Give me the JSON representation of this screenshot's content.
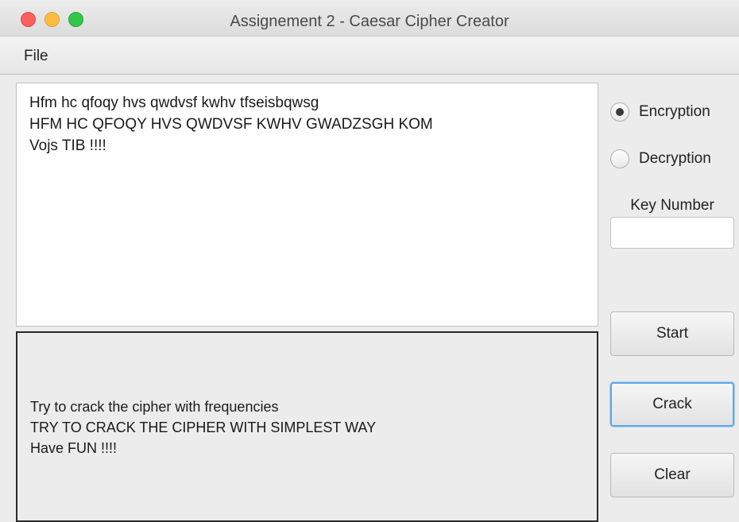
{
  "window": {
    "title": "Assignement 2 - Caesar Cipher Creator"
  },
  "menu": {
    "file_label": "File"
  },
  "input_text": "Hfm hc qfoqy hvs qwdvsf kwhv tfseisbqwsg\nHFM HC QFOQY HVS QWDVSF KWHV GWADZSGH KOM\nVojs TIB !!!!",
  "output_text": "Try to crack the cipher with frequencies\nTRY TO CRACK THE CIPHER WITH SIMPLEST WAY\nHave FUN !!!!",
  "mode": {
    "encryption_label": "Encryption",
    "decryption_label": "Decryption",
    "selected": "encryption"
  },
  "key": {
    "label": "Key Number",
    "value": "",
    "placeholder": ""
  },
  "buttons": {
    "start_label": "Start",
    "crack_label": "Crack",
    "clear_label": "Clear"
  },
  "colors": {
    "close": "#fc605c",
    "minimize": "#fdbc40",
    "zoom": "#34c84a",
    "focus_ring": "#5fa8e6"
  }
}
